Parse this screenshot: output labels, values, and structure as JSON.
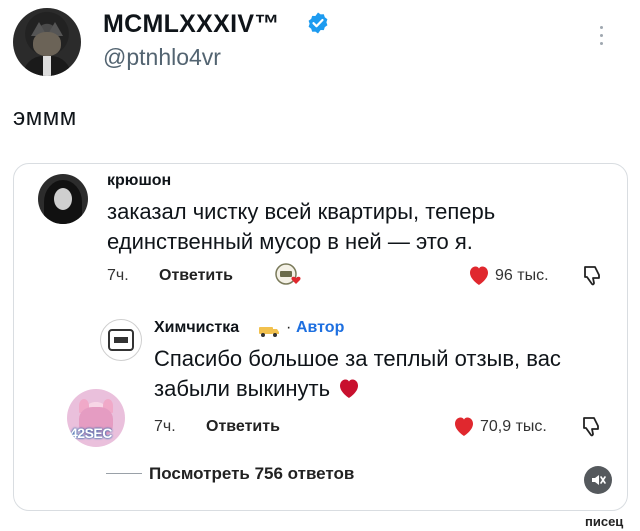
{
  "tweet": {
    "author_name": "MCMLXXXIV™",
    "handle": "@ptnhlo4vr",
    "text": "эммм"
  },
  "comment1": {
    "username": "крюшон",
    "text": "заказал чистку всей квартиры, теперь единственный мусор в ней — это я.",
    "time": "7ч.",
    "reply_label": "Ответить",
    "likes": "96 тыс."
  },
  "comment2": {
    "username": "Химчистка",
    "separator": "·",
    "author_badge": "Автор",
    "text": "Спасибо большое за теплый отзыв, вас забыли выкинуть",
    "time": "7ч.",
    "reply_label": "Ответить",
    "likes": "70,9 тыс."
  },
  "viewer_avatar_label": "42SEC",
  "view_replies_label": "Посмотреть 756 ответов",
  "watermark": "писец",
  "icons": {
    "verified": "verified-badge-icon",
    "more": "more-vertical-icon",
    "like": "heart-icon",
    "dislike": "thumb-down-icon",
    "mute": "mute-icon"
  },
  "colors": {
    "verified_blue": "#1d9bf0",
    "heart_red": "#e0282e",
    "author_blue": "#1d6fe0",
    "handle_gray": "#536471"
  }
}
